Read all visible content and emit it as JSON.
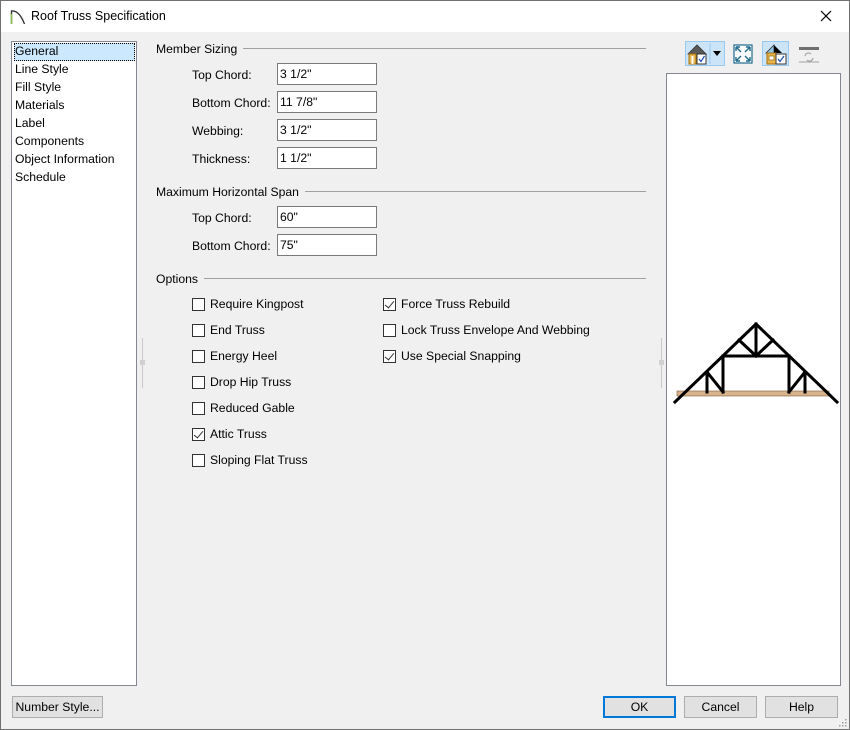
{
  "window": {
    "title": "Roof Truss Specification",
    "app_icon": "roof-arc-icon",
    "close_icon": "close-icon"
  },
  "sidebar": {
    "items": [
      {
        "label": "General",
        "selected": true
      },
      {
        "label": "Line Style",
        "selected": false
      },
      {
        "label": "Fill Style",
        "selected": false
      },
      {
        "label": "Materials",
        "selected": false
      },
      {
        "label": "Label",
        "selected": false
      },
      {
        "label": "Components",
        "selected": false
      },
      {
        "label": "Object Information",
        "selected": false
      },
      {
        "label": "Schedule",
        "selected": false
      }
    ]
  },
  "member_sizing": {
    "title": "Member Sizing",
    "fields": [
      {
        "label": "Top Chord:",
        "value": "3 1/2\""
      },
      {
        "label": "Bottom Chord:",
        "value": "11 7/8\""
      },
      {
        "label": "Webbing:",
        "value": "3 1/2\""
      },
      {
        "label": "Thickness:",
        "value": "1 1/2\""
      }
    ]
  },
  "max_span": {
    "title": "Maximum Horizontal Span",
    "fields": [
      {
        "label": "Top Chord:",
        "value": "60\""
      },
      {
        "label": "Bottom Chord:",
        "value": "75\""
      }
    ]
  },
  "options": {
    "title": "Options",
    "left": [
      {
        "label": "Require Kingpost",
        "checked": false
      },
      {
        "label": "End Truss",
        "checked": false
      },
      {
        "label": "Energy Heel",
        "checked": false
      },
      {
        "label": "Drop Hip Truss",
        "checked": false
      },
      {
        "label": "Reduced Gable",
        "checked": false
      },
      {
        "label": "Attic Truss",
        "checked": true
      },
      {
        "label": "Sloping Flat Truss",
        "checked": false
      }
    ],
    "right": [
      {
        "label": "Force Truss Rebuild",
        "checked": true
      },
      {
        "label": "Lock Truss Envelope And Webbing",
        "checked": false
      },
      {
        "label": "Use Special Snapping",
        "checked": true
      }
    ]
  },
  "preview_toolbar": {
    "buttons": [
      {
        "icon": "house-view-icon",
        "dropdown": true,
        "active": true
      },
      {
        "icon": "fill-window-icon",
        "active": false
      },
      {
        "icon": "house-render-icon",
        "active": true
      },
      {
        "icon": "refresh-icon",
        "active": false
      }
    ]
  },
  "colors": {
    "selection": "#cce8ff",
    "accent": "#0078d7",
    "bottom_chord_fill": "#d9b38c"
  },
  "footer": {
    "number_style_label": "Number Style...",
    "ok_label": "OK",
    "cancel_label": "Cancel",
    "help_label": "Help"
  }
}
